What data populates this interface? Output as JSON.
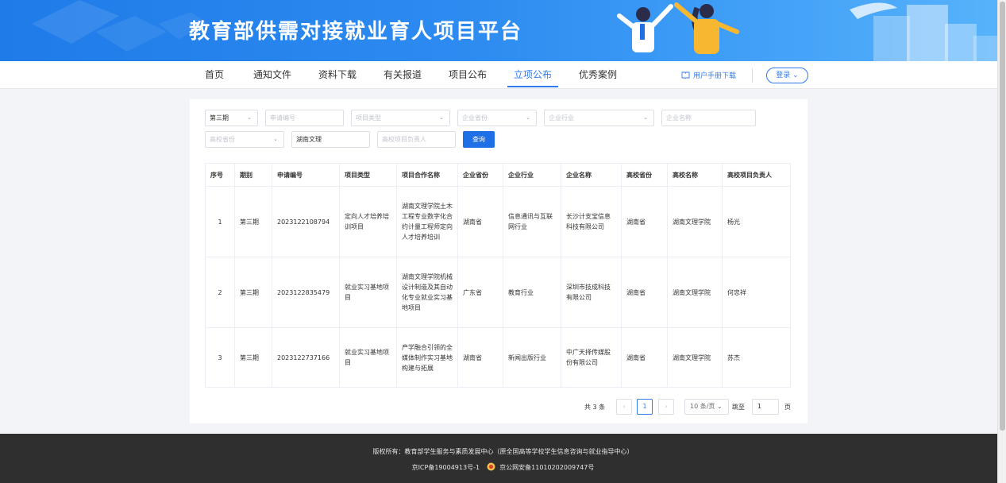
{
  "banner": {
    "title": "教育部供需对接就业育人项目平台"
  },
  "nav": {
    "items": [
      {
        "label": "首页",
        "active": false
      },
      {
        "label": "通知文件",
        "active": false
      },
      {
        "label": "资料下载",
        "active": false
      },
      {
        "label": "有关报道",
        "active": false
      },
      {
        "label": "项目公布",
        "active": false
      },
      {
        "label": "立项公布",
        "active": true
      },
      {
        "label": "优秀案例",
        "active": false
      }
    ],
    "manual_label": "用户手册下载",
    "login_label": "登录 ⌄"
  },
  "filters": {
    "period_value": "第三期",
    "apply_no_placeholder": "申请编号",
    "project_type_placeholder": "项目类型",
    "company_province_placeholder": "企业省份",
    "company_industry_placeholder": "企业行业",
    "company_name_placeholder": "企业名称",
    "school_province_placeholder": "高校省份",
    "school_name_value": "湖南文理",
    "school_leader_placeholder": "高校项目负责人",
    "query_label": "查询"
  },
  "table": {
    "headers": [
      "序号",
      "期别",
      "申请编号",
      "项目类型",
      "项目合作名称",
      "企业省份",
      "企业行业",
      "企业名称",
      "高校省份",
      "高校名称",
      "高校项目负责人"
    ],
    "rows": [
      [
        "1",
        "第三期",
        "2023122108794",
        "定向人才培养培训项目",
        "湖南文理学院土木工程专业数字化合约计量工程师定向人才培养培训",
        "湖南省",
        "信息通讯与互联网行业",
        "长沙计支宝信息科技有限公司",
        "湖南省",
        "湖南文理学院",
        "杨光"
      ],
      [
        "2",
        "第三期",
        "2023122835479",
        "就业实习基地项目",
        "湖南文理学院机械设计制造及其自动化专业就业实习基地项目",
        "广东省",
        "教育行业",
        "深圳市技成科技有限公司",
        "湖南省",
        "湖南文理学院",
        "何忠祥"
      ],
      [
        "3",
        "第三期",
        "2023122737166",
        "就业实习基地项目",
        "产学融合引领的全媒体制作实习基地构建与拓展",
        "湖南省",
        "新闻出版行业",
        "中广天择传媒股份有限公司",
        "湖南省",
        "湖南文理学院",
        "苏杰"
      ]
    ]
  },
  "pagination": {
    "total_label": "共 3 条",
    "prev": "‹",
    "current_page": "1",
    "next": "›",
    "page_size": "10 条/页 ⌄",
    "jump_label": "跳至",
    "jump_value": "1",
    "page_unit": "页"
  },
  "footer": {
    "copyright": "版权所有：教育部学生服务与素质发展中心（原全国高等学校学生信息咨询与就业指导中心）",
    "icp": "京ICP备19004913号-1",
    "police": "京公网安备11010202009747号"
  }
}
